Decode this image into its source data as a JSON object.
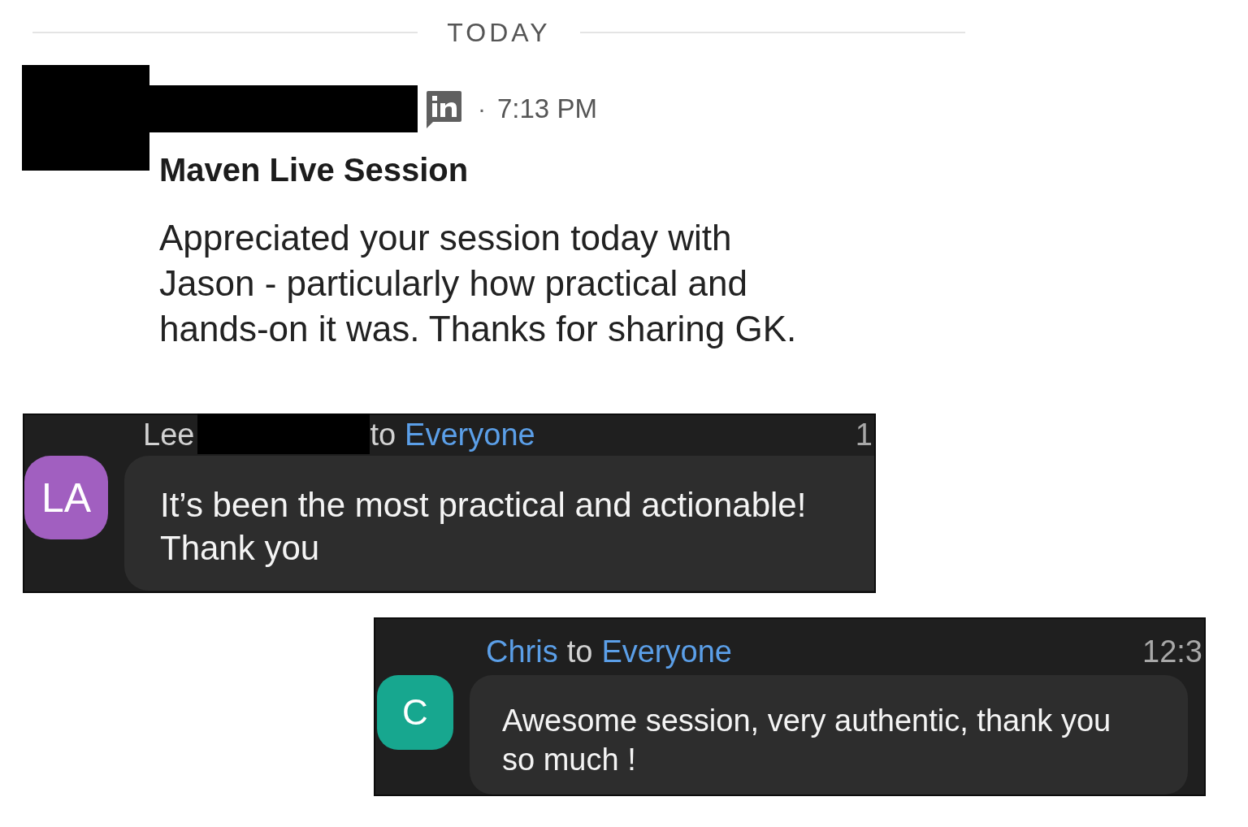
{
  "date_divider": {
    "label": "TODAY"
  },
  "post": {
    "separator": "·",
    "time": "7:13 PM",
    "title": "Maven Live Session",
    "message": "Appreciated your session today with Jason - particularly how practical and hands-on it was. Thanks for sharing GK."
  },
  "chat_messages": [
    {
      "sender": "Lee",
      "sender_highlighted": false,
      "sender_redacted": true,
      "to_word": "to",
      "recipient": "Everyone",
      "time": "1",
      "avatar_initials": "LA",
      "color": "#a15fc0",
      "text": "It’s been the most practical and actionable! Thank you"
    },
    {
      "sender": "Chris",
      "sender_highlighted": true,
      "sender_redacted": false,
      "to_word": "to",
      "recipient": "Everyone",
      "time": "12:3",
      "avatar_initials": "C",
      "color": "#17a78f",
      "text": "Awesome session, very authentic, thank you so much !"
    }
  ]
}
